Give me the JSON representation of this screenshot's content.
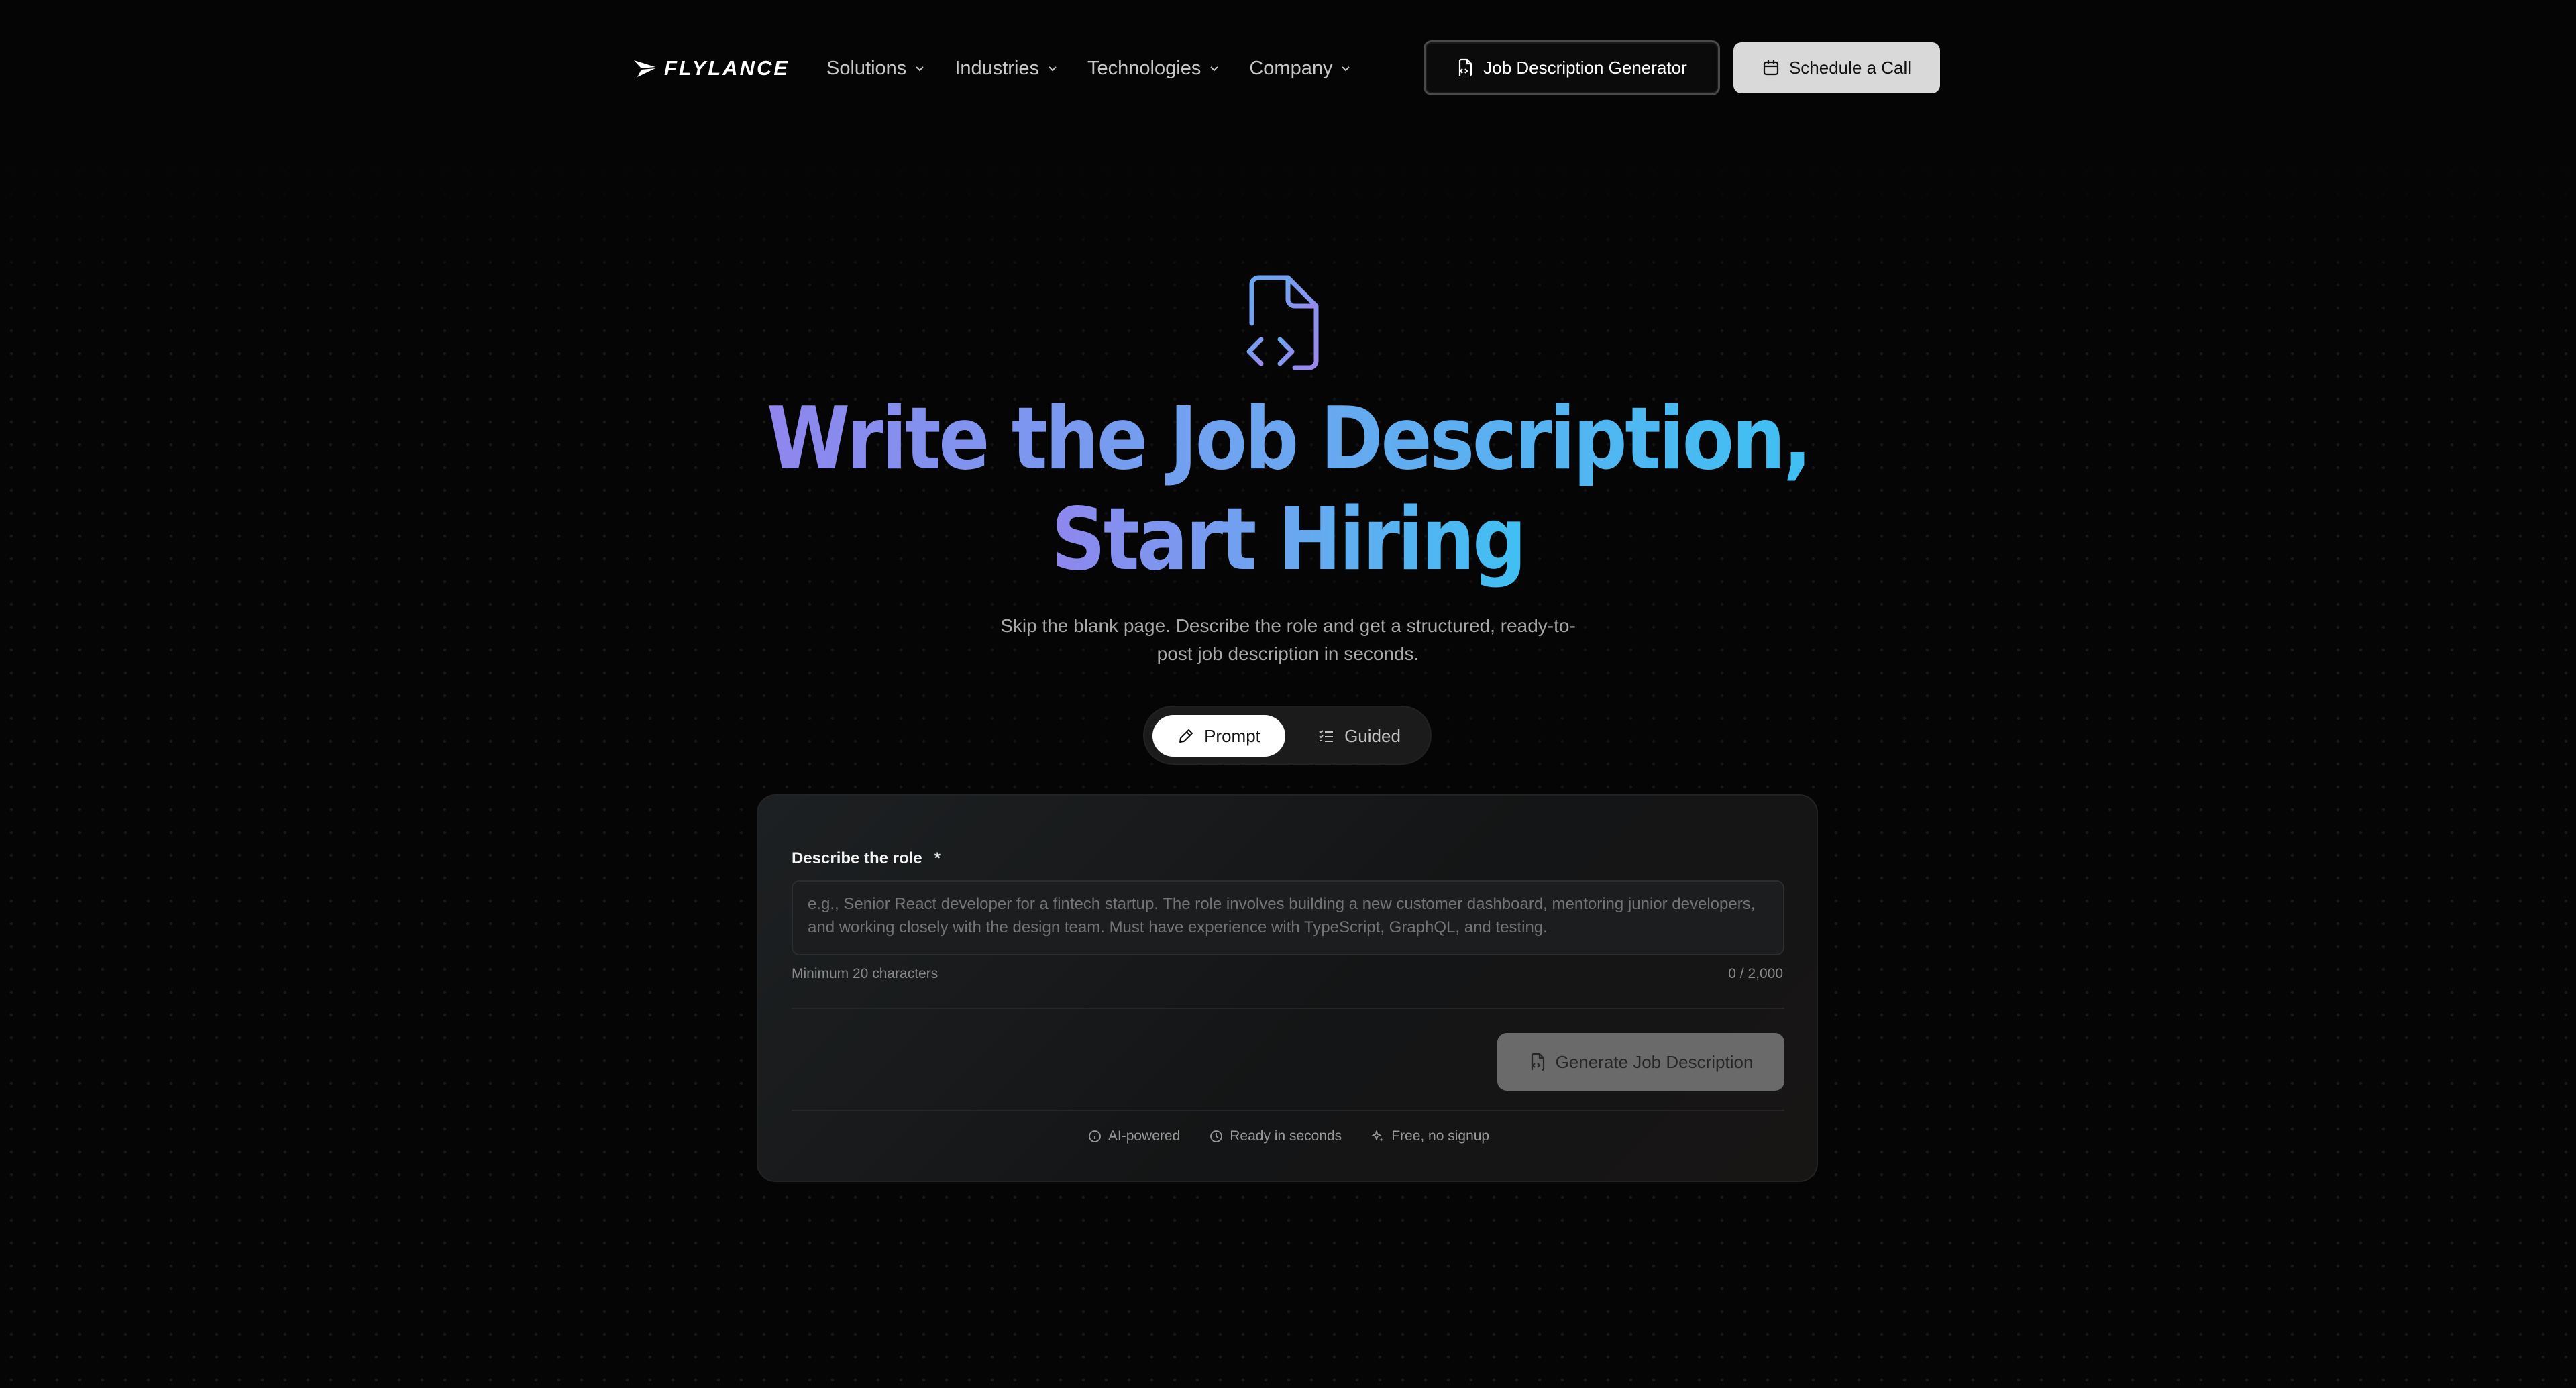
{
  "brand": {
    "name": "FLYLANCE"
  },
  "nav": {
    "items": [
      {
        "label": "Solutions"
      },
      {
        "label": "Industries"
      },
      {
        "label": "Technologies"
      },
      {
        "label": "Company"
      }
    ],
    "jd_generator_label": "Job Description Generator",
    "schedule_label": "Schedule a Call"
  },
  "hero": {
    "title_line1": "Write the Job Description,",
    "title_line2": "Start Hiring",
    "subtitle": "Skip the blank page. Describe the role and get a structured, ready-to-post job description in seconds."
  },
  "mode_toggle": {
    "options": [
      {
        "label": "Prompt",
        "selected": true
      },
      {
        "label": "Guided",
        "selected": false
      }
    ]
  },
  "form": {
    "label": "Describe the role",
    "required_mark": "*",
    "placeholder": "e.g., Senior React developer for a fintech startup. The role involves building a new customer dashboard, mentoring junior developers, and working closely with the design team. Must have experience with TypeScript, GraphQL, and testing.",
    "value": "",
    "hint": "Minimum 20 characters",
    "counter": "0 / 2,000",
    "generate_label": "Generate Job Description"
  },
  "features": [
    {
      "label": "AI-powered",
      "icon": "info-circle-icon"
    },
    {
      "label": "Ready in seconds",
      "icon": "clock-icon"
    },
    {
      "label": "Free, no signup",
      "icon": "sparkle-icon"
    }
  ],
  "colors": {
    "background": "#050505",
    "gradient_start": "#8f86ee",
    "gradient_end": "#3fc0f2",
    "primary_button": "#d9d9d9",
    "disabled_button": "#6a6a6a"
  }
}
